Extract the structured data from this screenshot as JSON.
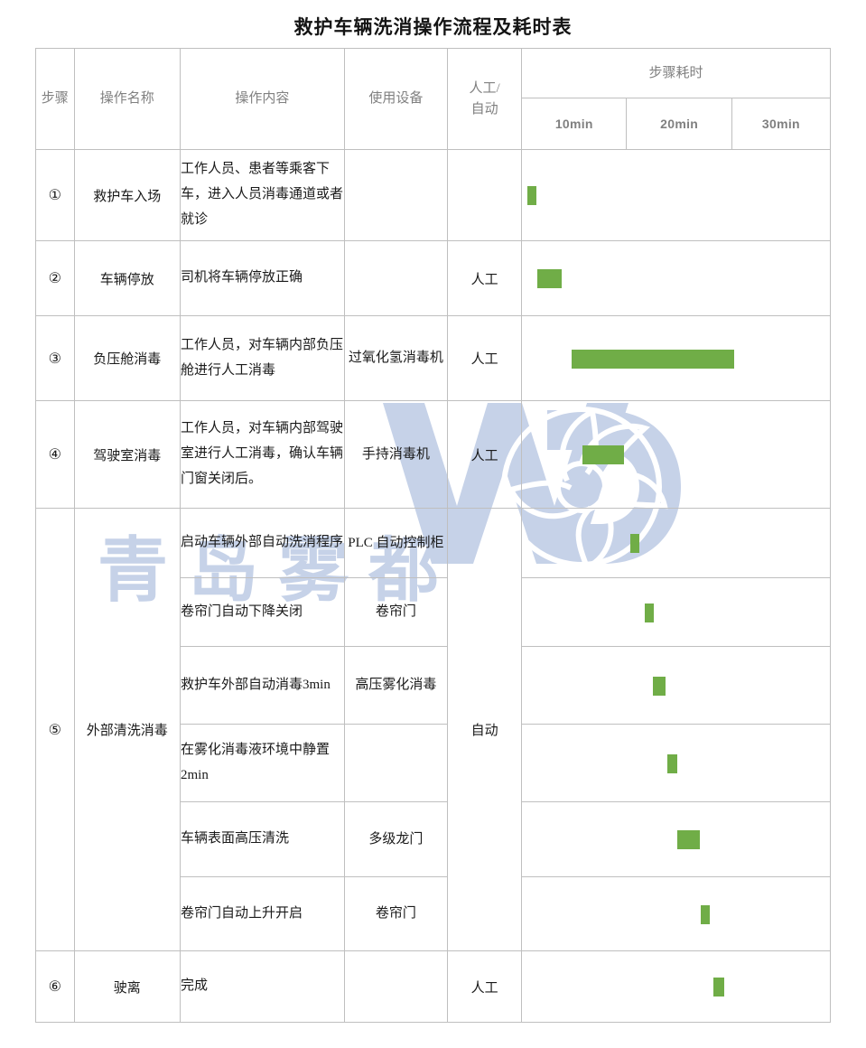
{
  "document": {
    "title": "救护车辆洗消操作流程及耗时表"
  },
  "watermark": {
    "text": "青岛雾都",
    "logo_name": "wd-fan-logo",
    "color": "#c6d2e8"
  },
  "table": {
    "headers": {
      "step": "步骤",
      "operation_name": "操作名称",
      "operation_content": "操作内容",
      "equipment": "使用设备",
      "mode": "人工/\n自动",
      "mode_line1": "人工/",
      "mode_line2": "自动",
      "duration_group": "步骤耗时",
      "time_cols": [
        "10min",
        "20min",
        "30min"
      ]
    },
    "bar_color": "#70ad47",
    "rows": [
      {
        "step": "①",
        "name": "救护车入场",
        "content": "工作人员、患者等乘客下车，进入人员消毒通道或者就诊",
        "equipment": "",
        "mode": "",
        "bar_start_pct": 1.6,
        "bar_width_pct": 3.2
      },
      {
        "step": "②",
        "name": "车辆停放",
        "content": "司机将车辆停放正确",
        "equipment": "",
        "mode": "人工",
        "bar_start_pct": 5.0,
        "bar_width_pct": 8.0
      },
      {
        "step": "③",
        "name": "负压舱消毒",
        "content": "工作人员，对车辆内部负压舱进行人工消毒",
        "equipment": "过氧化氢消毒机",
        "mode": "人工",
        "bar_start_pct": 16.2,
        "bar_width_pct": 52.8
      },
      {
        "step": "④",
        "name": "驾驶室消毒",
        "content": "工作人员，对车辆内部驾驶室进行人工消毒，确认车辆门窗关闭后。",
        "equipment": "手持消毒机",
        "mode": "人工",
        "bar_start_pct": 19.5,
        "bar_width_pct": 13.7
      },
      {
        "step": "⑤",
        "name": "外部清洗消毒",
        "content": "启动车辆外部自动洗消程序",
        "equipment": "PLC 自动控制柜",
        "mode": "自动",
        "bar_start_pct": 35.3,
        "bar_width_pct": 2.9
      },
      {
        "step": "",
        "name": "",
        "content": "卷帘门自动下降关闭",
        "equipment": "卷帘门",
        "mode": "",
        "bar_start_pct": 39.8,
        "bar_width_pct": 3.1
      },
      {
        "step": "",
        "name": "",
        "content": "救护车外部自动消毒3min",
        "equipment": "高压雾化消毒",
        "mode": "",
        "bar_start_pct": 42.6,
        "bar_width_pct": 4.0
      },
      {
        "step": "",
        "name": "",
        "content": "在雾化消毒液环境中静置 2min",
        "equipment": "",
        "mode": "",
        "bar_start_pct": 47.3,
        "bar_width_pct": 3.1
      },
      {
        "step": "",
        "name": "",
        "content": "车辆表面高压清洗",
        "equipment": "多级龙门",
        "mode": "",
        "bar_start_pct": 50.4,
        "bar_width_pct": 7.3
      },
      {
        "step": "",
        "name": "",
        "content": "卷帘门自动上升开启",
        "equipment": "卷帘门",
        "mode": "",
        "bar_start_pct": 58.0,
        "bar_width_pct": 3.1
      },
      {
        "step": "⑥",
        "name": "驶离",
        "content": "完成",
        "equipment": "",
        "mode": "人工",
        "bar_start_pct": 62.3,
        "bar_width_pct": 3.3
      }
    ]
  },
  "chart_data": {
    "type": "bar",
    "title": "救护车辆洗消操作流程及耗时表",
    "xlabel": "步骤耗时",
    "ylabel": "步骤",
    "xlim": [
      0,
      30
    ],
    "xticks": [
      10,
      20,
      30
    ],
    "xtick_labels": [
      "10min",
      "20min",
      "30min"
    ],
    "grid": true,
    "legend": "none",
    "orientation": "horizontal-gantt",
    "categories": [
      "① 救护车入场",
      "② 车辆停放",
      "③ 负压舱消毒",
      "④ 驾驶室消毒",
      "⑤ 启动车辆外部自动洗消程序",
      "⑤ 卷帘门自动下降关闭",
      "⑤ 救护车外部自动消毒3min",
      "⑤ 在雾化消毒液环境中静置 2min",
      "⑤ 车辆表面高压清洗",
      "⑤ 卷帘门自动上升开启",
      "⑥ 驶离"
    ],
    "bars": [
      {
        "label": "① 救护车入场",
        "start_min": 0.5,
        "end_min": 1.4,
        "duration_min": 0.9
      },
      {
        "label": "② 车辆停放",
        "start_min": 1.5,
        "end_min": 3.9,
        "duration_min": 2.4
      },
      {
        "label": "③ 负压舱消毒",
        "start_min": 4.9,
        "end_min": 20.7,
        "duration_min": 15.8
      },
      {
        "label": "④ 驾驶室消毒",
        "start_min": 5.9,
        "end_min": 10.0,
        "duration_min": 4.1
      },
      {
        "label": "⑤ 启动车辆外部自动洗消程序",
        "start_min": 10.6,
        "end_min": 11.5,
        "duration_min": 0.9
      },
      {
        "label": "⑤ 卷帘门自动下降关闭",
        "start_min": 11.9,
        "end_min": 12.9,
        "duration_min": 1.0
      },
      {
        "label": "⑤ 救护车外部自动消毒3min",
        "start_min": 12.8,
        "end_min": 14.0,
        "duration_min": 1.2
      },
      {
        "label": "⑤ 在雾化消毒液环境中静置 2min",
        "start_min": 14.2,
        "end_min": 15.1,
        "duration_min": 0.9
      },
      {
        "label": "⑤ 车辆表面高压清洗",
        "start_min": 15.1,
        "end_min": 17.3,
        "duration_min": 2.2
      },
      {
        "label": "⑤ 卷帘门自动上升开启",
        "start_min": 17.4,
        "end_min": 18.3,
        "duration_min": 0.9
      },
      {
        "label": "⑥ 驶离",
        "start_min": 18.7,
        "end_min": 19.7,
        "duration_min": 1.0
      }
    ],
    "bar_color": "#70ad47"
  }
}
